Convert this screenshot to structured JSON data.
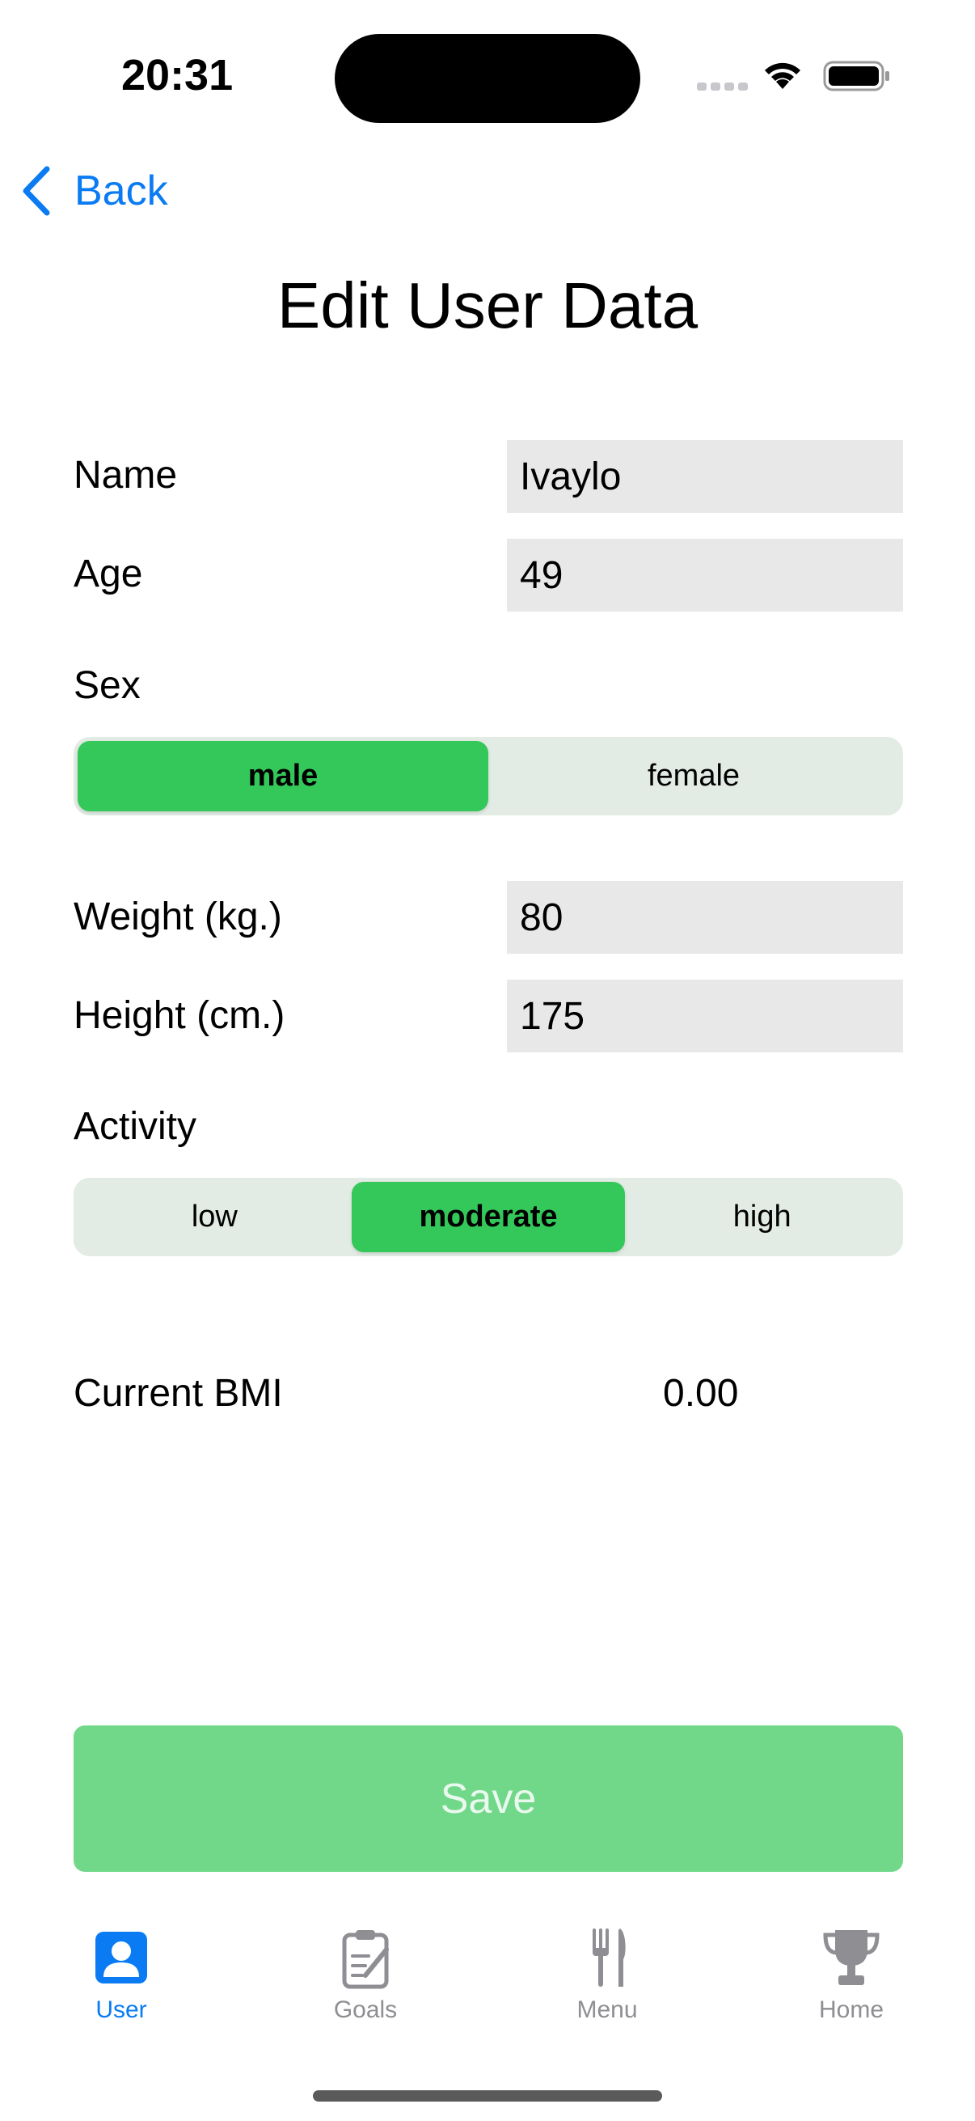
{
  "status_bar": {
    "time": "20:31"
  },
  "nav": {
    "back_label": "Back"
  },
  "title": "Edit User Data",
  "form": {
    "name": {
      "label": "Name",
      "value": "Ivaylo"
    },
    "age": {
      "label": "Age",
      "value": "49"
    },
    "sex": {
      "label": "Sex",
      "options": [
        "male",
        "female"
      ],
      "selected": "male"
    },
    "weight": {
      "label": "Weight (kg.)",
      "value": "80"
    },
    "height": {
      "label": "Height (cm.)",
      "value": "175"
    },
    "activity": {
      "label": "Activity",
      "options": [
        "low",
        "moderate",
        "high"
      ],
      "selected": "moderate"
    },
    "bmi": {
      "label": "Current BMI",
      "value": "0.00"
    }
  },
  "save_label": "Save",
  "tabs": [
    {
      "label": "User",
      "icon": "person-icon",
      "active": true
    },
    {
      "label": "Goals",
      "icon": "clipboard-icon",
      "active": false
    },
    {
      "label": "Menu",
      "icon": "fork-knife-icon",
      "active": false
    },
    {
      "label": "Home",
      "icon": "trophy-icon",
      "active": false
    }
  ],
  "colors": {
    "accent": "#0a7bf2",
    "selected_segment": "#34c759",
    "save_button": "#71d88a",
    "field_bg": "#e8e8e8",
    "segment_bg": "#e2ebe4"
  }
}
